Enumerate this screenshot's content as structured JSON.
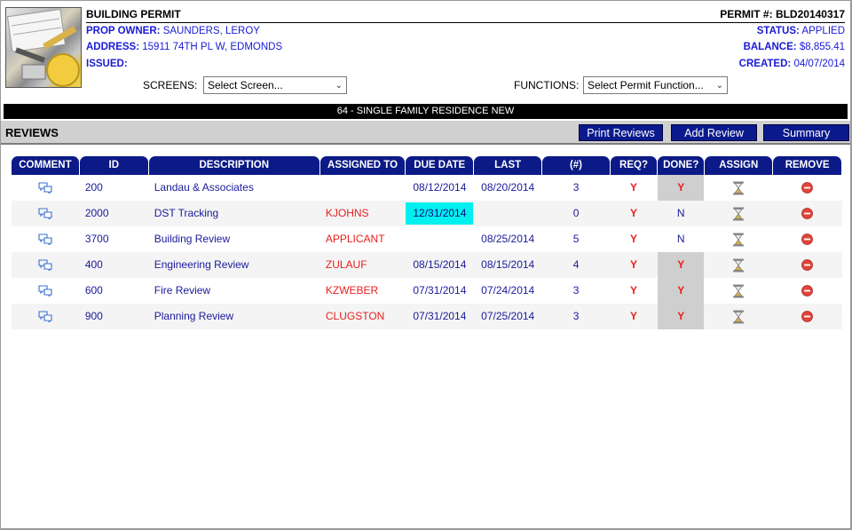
{
  "header": {
    "title": "BUILDING PERMIT",
    "permit_label": "PERMIT #:",
    "permit_number": "BLD20140317",
    "owner_label": "PROP OWNER:",
    "owner": "SAUNDERS, LEROY",
    "address_label": "ADDRESS:",
    "address": "15911 74TH PL W, EDMONDS",
    "issued_label": "ISSUED:",
    "issued": "",
    "status_label": "STATUS:",
    "status": "APPLIED",
    "balance_label": "BALANCE:",
    "balance": "$8,855.41",
    "created_label": "CREATED:",
    "created": "04/07/2014"
  },
  "screens": {
    "label": "SCREENS:",
    "value": "Select Screen..."
  },
  "functions": {
    "label": "FUNCTIONS:",
    "value": "Select Permit Function..."
  },
  "permit_type": "64 - SINGLE FAMILY RESIDENCE NEW",
  "reviews": {
    "title": "REVIEWS",
    "print_label": "Print Reviews",
    "add_label": "Add Review",
    "summary_label": "Summary"
  },
  "columns": [
    "COMMENT",
    "ID",
    "DESCRIPTION",
    "ASSIGNED TO",
    "DUE DATE",
    "LAST",
    "(#)",
    "REQ?",
    "DONE?",
    "ASSIGN",
    "REMOVE"
  ],
  "rows": [
    {
      "id": "200",
      "description": "Landau & Associates",
      "assigned": "",
      "due": "08/12/2014",
      "last": "08/20/2014",
      "count": "3",
      "req": "Y",
      "done": "Y",
      "due_highlight": false
    },
    {
      "id": "2000",
      "description": "DST Tracking",
      "assigned": "KJOHNS",
      "due": "12/31/2014",
      "last": "",
      "count": "0",
      "req": "Y",
      "done": "N",
      "due_highlight": true
    },
    {
      "id": "3700",
      "description": "Building Review",
      "assigned": "APPLICANT",
      "due": "",
      "last": "08/25/2014",
      "count": "5",
      "req": "Y",
      "done": "N",
      "due_highlight": false
    },
    {
      "id": "400",
      "description": "Engineering Review",
      "assigned": "ZULAUF",
      "due": "08/15/2014",
      "last": "08/15/2014",
      "count": "4",
      "req": "Y",
      "done": "Y",
      "due_highlight": false
    },
    {
      "id": "600",
      "description": "Fire Review",
      "assigned": "KZWEBER",
      "due": "07/31/2014",
      "last": "07/24/2014",
      "count": "3",
      "req": "Y",
      "done": "Y",
      "due_highlight": false
    },
    {
      "id": "900",
      "description": "Planning Review",
      "assigned": "CLUGSTON",
      "due": "07/31/2014",
      "last": "07/25/2014",
      "count": "3",
      "req": "Y",
      "done": "Y",
      "due_highlight": false
    }
  ],
  "icons": {
    "comment": "speech-bubbles-icon",
    "assign": "hourglass-icon",
    "remove": "remove-circle-icon"
  },
  "colors": {
    "header_navy": "#0b1a86",
    "accent_blue": "#1a1ad6",
    "alert_red": "#e8201e",
    "highlight_cyan": "#00f0f0"
  }
}
